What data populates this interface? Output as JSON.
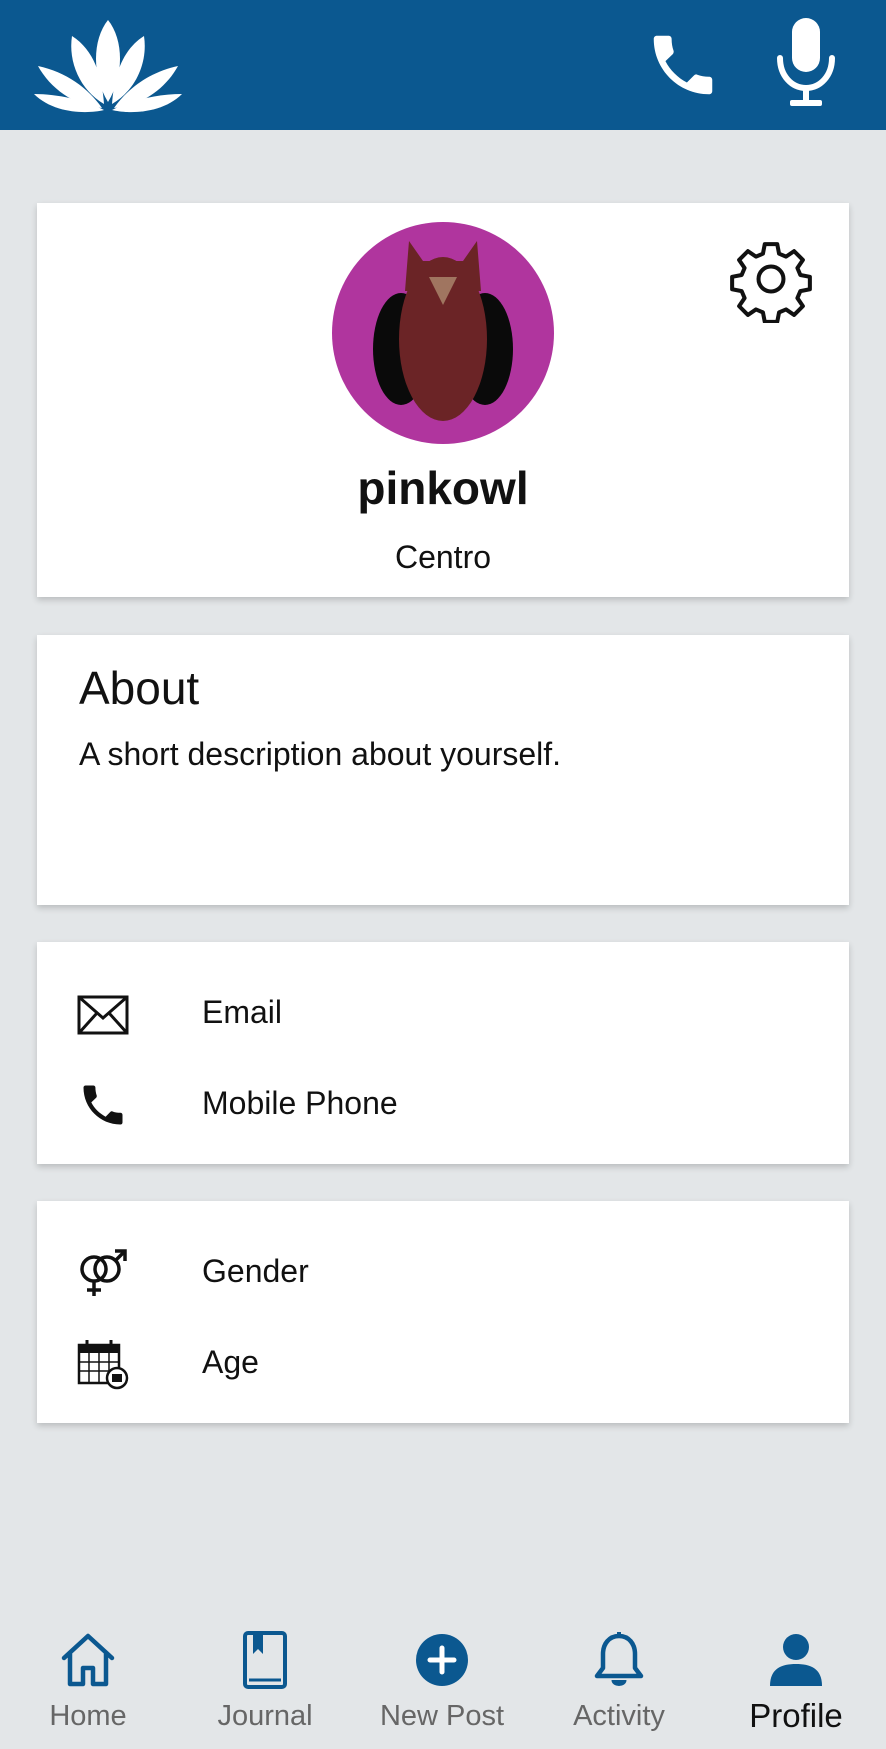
{
  "colors": {
    "brand": "#0b5890",
    "avatar_bg": "#b0359e",
    "owl": "#6b2426",
    "background": "#e3e6e8"
  },
  "header": {
    "icons": [
      "lotus-logo-icon",
      "phone-icon",
      "microphone-icon"
    ]
  },
  "profile": {
    "username": "pinkowl",
    "location": "Centro"
  },
  "about": {
    "title": "About",
    "text": "A short description about yourself."
  },
  "contact": {
    "email_label": "Email",
    "phone_label": "Mobile Phone"
  },
  "personal": {
    "gender_label": "Gender",
    "age_label": "Age"
  },
  "nav": {
    "home": "Home",
    "journal": "Journal",
    "new_post": "New Post",
    "activity": "Activity",
    "profile": "Profile",
    "active": "Profile"
  }
}
